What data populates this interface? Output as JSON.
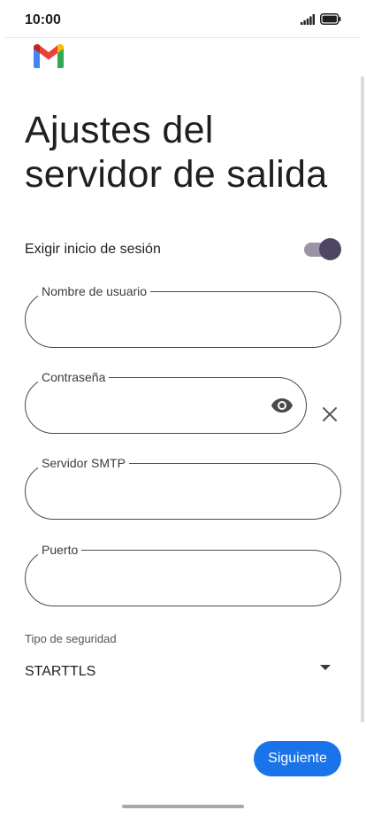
{
  "status_bar": {
    "time": "10:00",
    "signal_icon": "signal-icon",
    "battery_icon": "battery-icon"
  },
  "app": {
    "logo_icon": "gmail-logo-icon",
    "colors": {
      "red": "#ea4335",
      "blue": "#4285f4",
      "green": "#34a853",
      "yellow": "#fbbc04",
      "darkred": "#c5221f"
    }
  },
  "page": {
    "title": "Ajustes del servidor de salida"
  },
  "login_switch": {
    "label": "Exigir inicio de sesión",
    "enabled": true
  },
  "fields": {
    "username": {
      "label": "Nombre de usuario",
      "value": ""
    },
    "password": {
      "label": "Contraseña",
      "value": "",
      "toggle_icon": "eye-icon",
      "clear_icon": "close-icon"
    },
    "smtp_server": {
      "label": "Servidor SMTP",
      "value": ""
    },
    "port": {
      "label": "Puerto",
      "value": ""
    }
  },
  "security": {
    "label": "Tipo de seguridad",
    "selected": "STARTTLS",
    "dropdown_icon": "caret-down-icon"
  },
  "actions": {
    "next_label": "Siguiente",
    "accent": "#1a73e8"
  }
}
